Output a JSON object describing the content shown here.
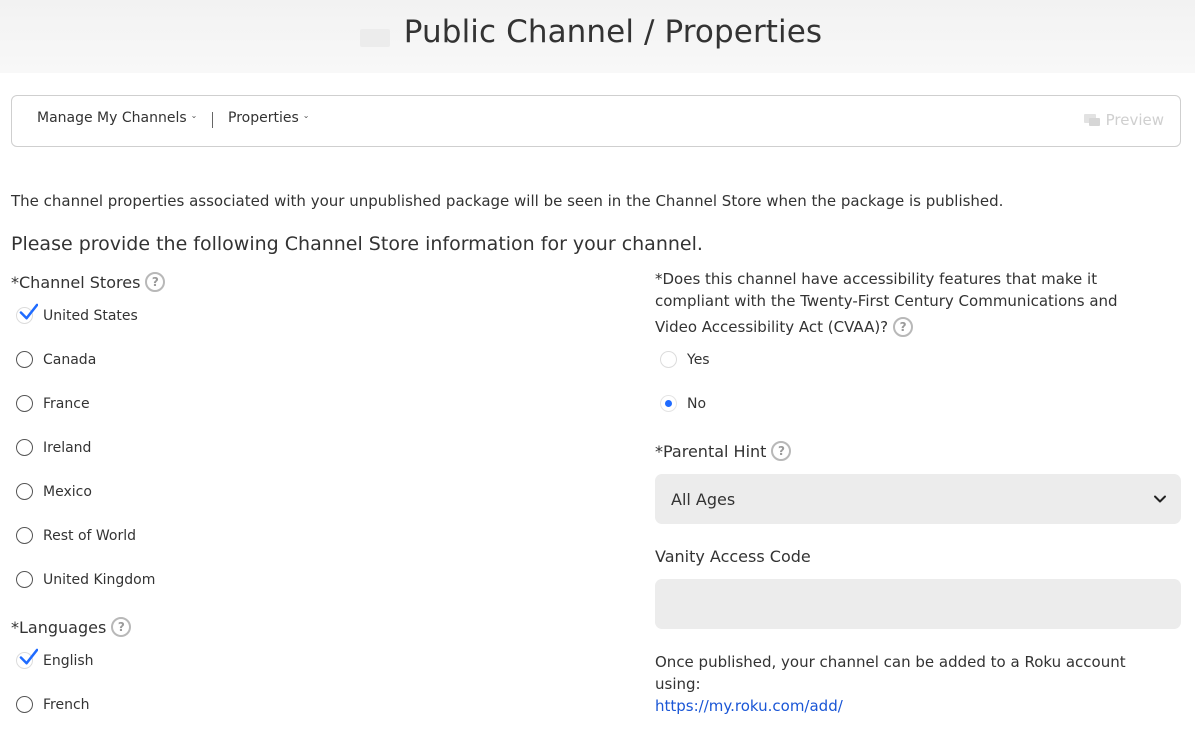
{
  "header": {
    "title": "Public Channel / Properties"
  },
  "nav": {
    "manage_label": "Manage My Channels",
    "properties_label": "Properties",
    "preview_label": "Preview"
  },
  "intro": "The channel properties associated with your unpublished package will be seen in the Channel Store when the package is published.",
  "section_heading": "Please provide the following Channel Store information for your channel.",
  "channel_stores": {
    "label": "*Channel Stores",
    "options": [
      {
        "label": "United States",
        "selected": true
      },
      {
        "label": "Canada",
        "selected": false
      },
      {
        "label": "France",
        "selected": false
      },
      {
        "label": "Ireland",
        "selected": false
      },
      {
        "label": "Mexico",
        "selected": false
      },
      {
        "label": "Rest of World",
        "selected": false
      },
      {
        "label": "United Kingdom",
        "selected": false
      }
    ]
  },
  "languages": {
    "label": "*Languages",
    "options": [
      {
        "label": "English",
        "selected": true
      },
      {
        "label": "French",
        "selected": false
      }
    ]
  },
  "cvaa": {
    "line1": "*Does this channel have accessibility features that make it",
    "line2": "compliant with the Twenty-First Century Communications and",
    "line3": "Video Accessibility Act (CVAA)?",
    "options": [
      {
        "label": "Yes",
        "selected": false
      },
      {
        "label": "No",
        "selected": true
      }
    ]
  },
  "parental_hint": {
    "label": "*Parental Hint",
    "value": "All Ages"
  },
  "vanity_access_code": {
    "label": "Vanity Access Code",
    "value": ""
  },
  "once_published": {
    "text": "Once published, your channel can be added to a Roku account using:",
    "link": "https://my.roku.com/add/"
  },
  "colors": {
    "accent": "#1f6bff",
    "link": "#1a56d6",
    "help_icon": "#b8b8b8",
    "field_bg": "#ececec"
  }
}
